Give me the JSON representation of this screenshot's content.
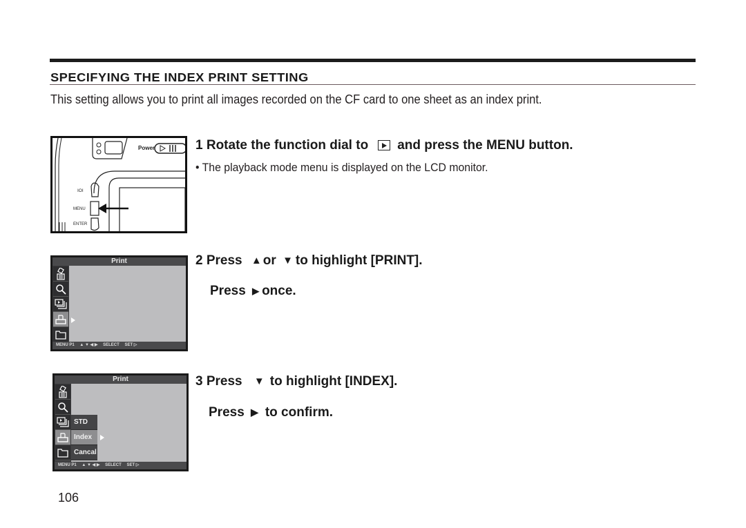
{
  "section": {
    "title": "SPECIFYING THE INDEX PRINT SETTING",
    "intro": "This setting allows you to print all images recorded on the CF card to one sheet as an index print."
  },
  "steps": [
    {
      "number": "1",
      "title_before_icon": "Rotate the function dial to",
      "icon": "playback-mode-icon",
      "title_after_icon": "and press the MENU button.",
      "note": "• The playback mode menu is displayed on the LCD monitor."
    },
    {
      "number": "2",
      "line1_prefix": "Press",
      "up_glyph": "▲",
      "line1_or": "or",
      "down_glyph": "▼",
      "line1_suffix": "to highlight [PRINT].",
      "line2_prefix": "Press",
      "right_glyph": "▶",
      "line2_suffix": "once."
    },
    {
      "number": "3",
      "line1_prefix": "Press",
      "down_glyph": "▼",
      "line1_suffix": "to highlight [INDEX].",
      "line2_prefix": "Press",
      "right_glyph": "▶",
      "line2_suffix": "to confirm."
    }
  ],
  "camera_illustration": {
    "power_label": "Power",
    "button_labels": [
      "IOI",
      "MENU",
      "ENTER"
    ]
  },
  "lcd": {
    "header": "Print",
    "side_icons": [
      "delete-icon",
      "magnify-icon",
      "slideshow-icon",
      "print-icon",
      "folder-icon"
    ],
    "footer": {
      "menu": "MENU P1",
      "arrows": "▲ ▼ ◀ ▶",
      "select": "SELECT",
      "set": "SET ▷"
    },
    "submenu_items": [
      "STD",
      "Index",
      "Cancal"
    ]
  },
  "page_number": "106"
}
